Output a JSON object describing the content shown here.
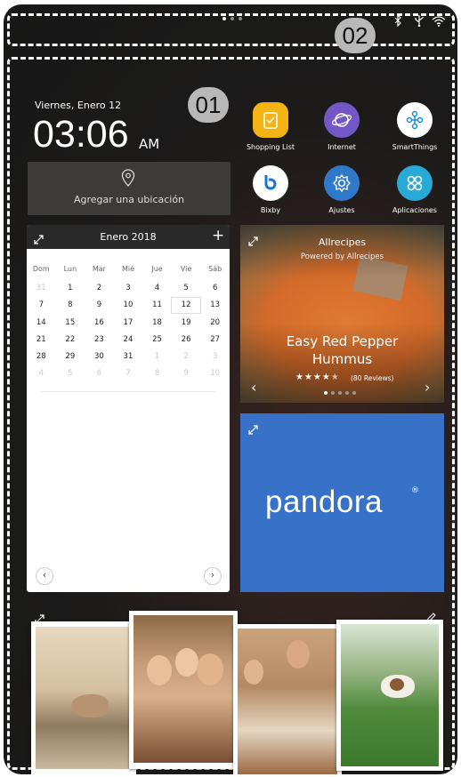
{
  "callouts": {
    "c1": "01",
    "c2": "02"
  },
  "clock": {
    "date": "Viernes, Enero 12",
    "time": "03:06",
    "ampm": "AM"
  },
  "location": {
    "label": "Agregar una ubicación"
  },
  "apps": [
    {
      "label": "Shopping List",
      "icon": "shopping-list-icon",
      "color": "#f2b313"
    },
    {
      "label": "Internet",
      "icon": "internet-icon",
      "color": "#7457c7"
    },
    {
      "label": "SmartThings",
      "icon": "smartthings-icon",
      "color": "#ffffff"
    },
    {
      "label": "Bixby",
      "icon": "bixby-icon",
      "color": "#ffffff"
    },
    {
      "label": "Ajustes",
      "icon": "settings-icon",
      "color": "#2f79c8"
    },
    {
      "label": "Aplicaciones",
      "icon": "apps-icon",
      "color": "#28a9d6"
    }
  ],
  "calendar": {
    "title": "Enero 2018",
    "weekdays": [
      "Dom",
      "Lun",
      "Mar",
      "Mié",
      "Jue",
      "Vie",
      "Sáb"
    ],
    "weeks": [
      [
        "31",
        "1",
        "2",
        "3",
        "4",
        "5",
        "6"
      ],
      [
        "7",
        "8",
        "9",
        "10",
        "11",
        "12",
        "13"
      ],
      [
        "14",
        "15",
        "16",
        "17",
        "18",
        "19",
        "20"
      ],
      [
        "21",
        "22",
        "23",
        "24",
        "25",
        "26",
        "27"
      ],
      [
        "28",
        "29",
        "30",
        "31",
        "1",
        "2",
        "3"
      ],
      [
        "4",
        "5",
        "6",
        "7",
        "8",
        "9",
        "10"
      ]
    ],
    "selected": "12"
  },
  "recipe": {
    "source": "Allrecipes",
    "powered": "Powered by Allrecipes",
    "title_line1": "Easy Red Pepper",
    "title_line2": "Hummus",
    "reviews": "(80 Reviews)",
    "rating": 4.5
  },
  "pandora": {
    "logo": "pandora",
    "mark": "®"
  }
}
